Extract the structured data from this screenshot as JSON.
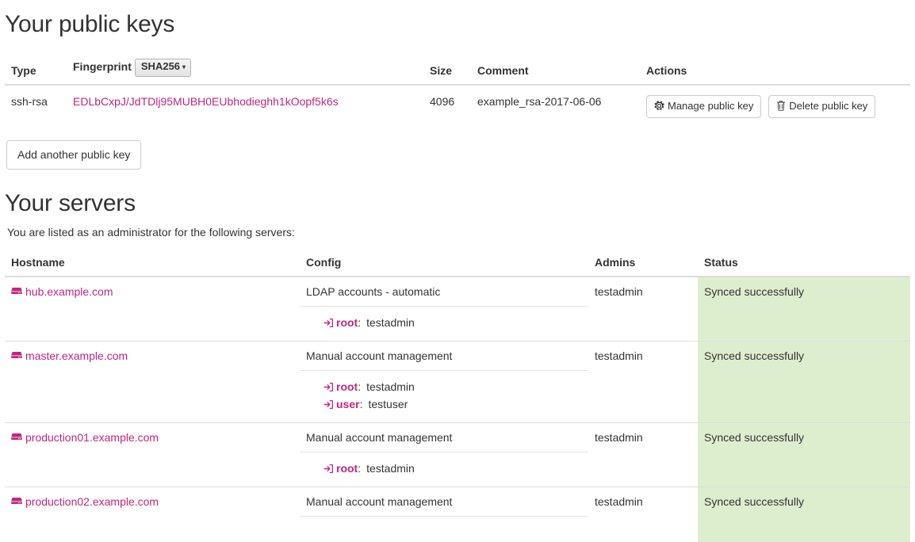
{
  "keys_section": {
    "title": "Your public keys",
    "columns": {
      "type": "Type",
      "fingerprint": "Fingerprint",
      "size": "Size",
      "comment": "Comment",
      "actions": "Actions"
    },
    "hash_type": "SHA256",
    "hash_caret": "▾",
    "rows": [
      {
        "type": "ssh-rsa",
        "fingerprint": "EDLbCxpJ/JdTDlj95MUBH0EUbhodieghh1kOopf5k6s",
        "size": "4096",
        "comment": "example_rsa-2017-06-06",
        "manage_label": "Manage public key",
        "delete_label": "Delete public key"
      }
    ],
    "add_key_label": "Add another public key"
  },
  "servers_section": {
    "title": "Your servers",
    "lead": "You are listed as an administrator for the following servers:",
    "columns": {
      "hostname": "Hostname",
      "config": "Config",
      "admins": "Admins",
      "status": "Status"
    },
    "rows": [
      {
        "hostname": "hub.example.com",
        "config": "LDAP accounts - automatic",
        "accounts": [
          {
            "name": "root",
            "separator": ":",
            "user": "testadmin"
          }
        ],
        "admins": "testadmin",
        "status": "Synced successfully"
      },
      {
        "hostname": "master.example.com",
        "config": "Manual account management",
        "accounts": [
          {
            "name": "root",
            "separator": ":",
            "user": "testadmin"
          },
          {
            "name": "user",
            "separator": ":",
            "user": "testuser"
          }
        ],
        "admins": "testadmin",
        "status": "Synced successfully"
      },
      {
        "hostname": "production01.example.com",
        "config": "Manual account management",
        "accounts": [
          {
            "name": "root",
            "separator": ":",
            "user": "testadmin"
          }
        ],
        "admins": "testadmin",
        "status": "Synced successfully"
      },
      {
        "hostname": "production02.example.com",
        "config": "Manual account management",
        "accounts": [],
        "admins": "testadmin",
        "status": "Synced successfully"
      }
    ]
  },
  "colors": {
    "link": "#c0267e",
    "status_bg": "#ddeece",
    "text": "#333333",
    "border": "#dddddd"
  }
}
